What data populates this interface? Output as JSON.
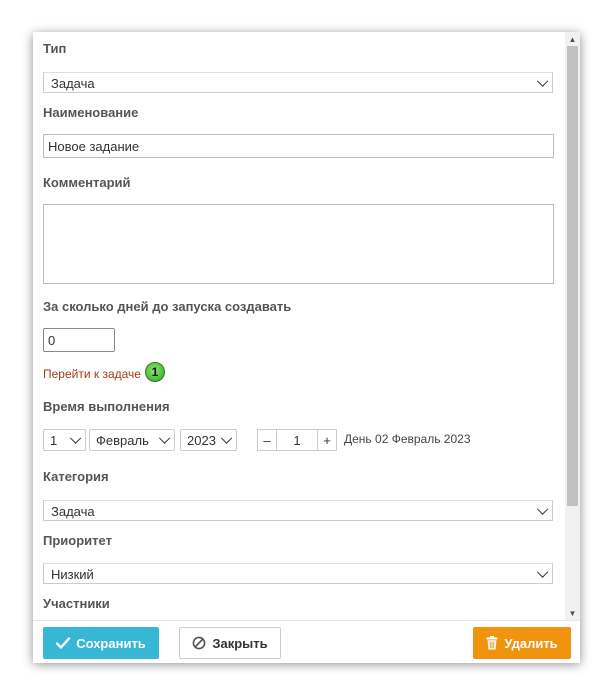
{
  "form": {
    "type_label": "Тип",
    "type_value": "Задача",
    "name_label": "Наименование",
    "name_value": "Новое задание",
    "comment_label": "Комментарий",
    "comment_value": "",
    "days_label": "За сколько дней до запуска создавать",
    "days_value": "0",
    "goto_link": "Перейти к задаче",
    "badge_count": "1",
    "exec_time_label": "Время выполнения",
    "day_value": "1",
    "month_value": "Февраль",
    "year_value": "2023",
    "stepper_minus": "–",
    "stepper_value": "1",
    "stepper_plus": "+",
    "day_description": "День 02 Февраль 2023",
    "category_label": "Категория",
    "category_value": "Задача",
    "priority_label": "Приоритет",
    "priority_value": "Низкий",
    "participants_label": "Участники"
  },
  "footer": {
    "save_label": "Сохранить",
    "close_label": "Закрыть",
    "delete_label": "Удалить"
  },
  "colors": {
    "save": "#36b7d3",
    "delete": "#f0930e",
    "link": "#a33a1a",
    "badge": "#52c23a"
  },
  "icons": {
    "save": "check-icon",
    "close": "ban-icon",
    "delete": "trash-icon",
    "select": "chevron-down-icon"
  }
}
